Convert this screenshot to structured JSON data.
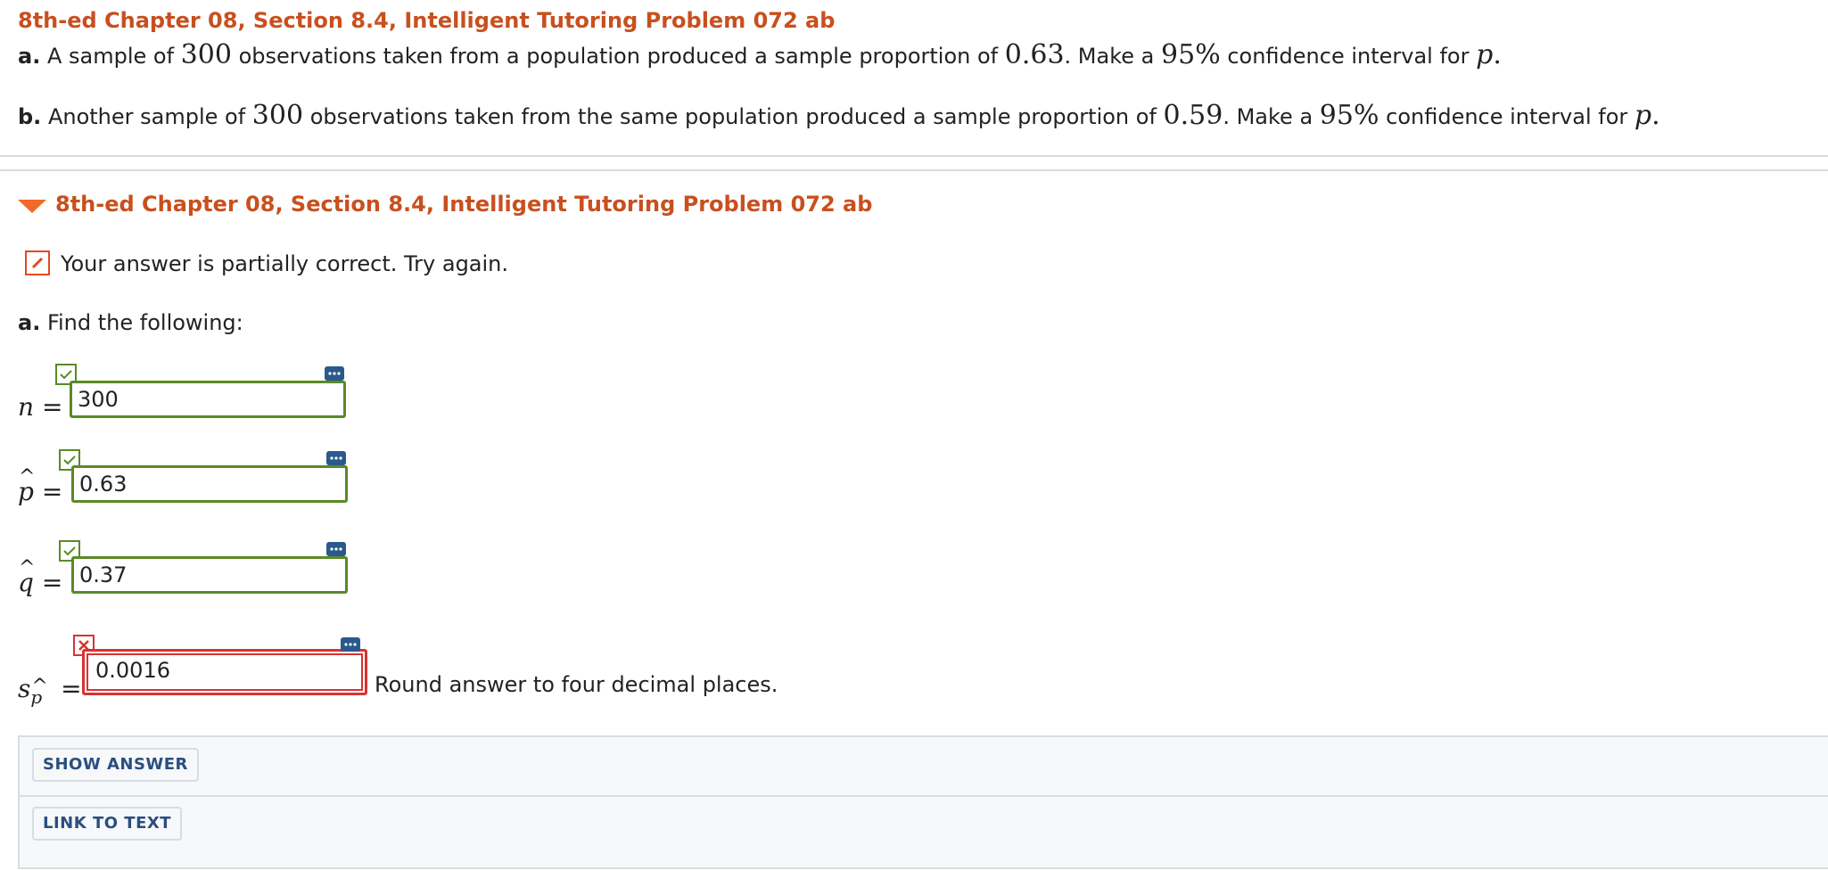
{
  "problem_title": "8th-ed Chapter 08, Section 8.4, Intelligent Tutoring Problem 072 ab",
  "question": {
    "a": {
      "label": "a.",
      "t1": "A sample of",
      "n": "300",
      "t2": "observations taken from a population produced a sample proportion of",
      "p": "0.63",
      "t3": ". Make a",
      "conf": "95%",
      "t4": "confidence interval for",
      "var": "p",
      "end": "."
    },
    "b": {
      "label": "b.",
      "t1": "Another sample of",
      "n": "300",
      "t2": "observations taken from the same population produced a sample proportion of",
      "p": "0.59",
      "t3": ". Make a",
      "conf": "95%",
      "t4": "confidence interval for",
      "var": "p",
      "end": "."
    }
  },
  "section": {
    "title": "8th-ed Chapter 08, Section 8.4, Intelligent Tutoring Problem 072 ab"
  },
  "status": {
    "text": "Your answer is partially correct.  Try again."
  },
  "part_a": {
    "label": "a.",
    "text": "Find the following:"
  },
  "answers": {
    "n": {
      "var": "n",
      "eq": "=",
      "value": "300",
      "correct": true
    },
    "p_hat": {
      "var": "p",
      "eq": "=",
      "value": "0.63",
      "correct": true
    },
    "q_hat": {
      "var": "q",
      "eq": "=",
      "value": "0.37",
      "correct": true
    },
    "s_p_hat": {
      "var": "s",
      "sub": "p",
      "eq": "=",
      "value": "0.0016",
      "correct": false
    }
  },
  "round_note": "Round answer to four decimal places.",
  "buttons": {
    "show_answer": "SHOW ANSWER",
    "link_to_text": "LINK TO TEXT"
  },
  "colors": {
    "accent_orange": "#c8501e",
    "correct_green": "#5a8a26",
    "wrong_red": "#d73333",
    "button_blue": "#2a4e80"
  }
}
